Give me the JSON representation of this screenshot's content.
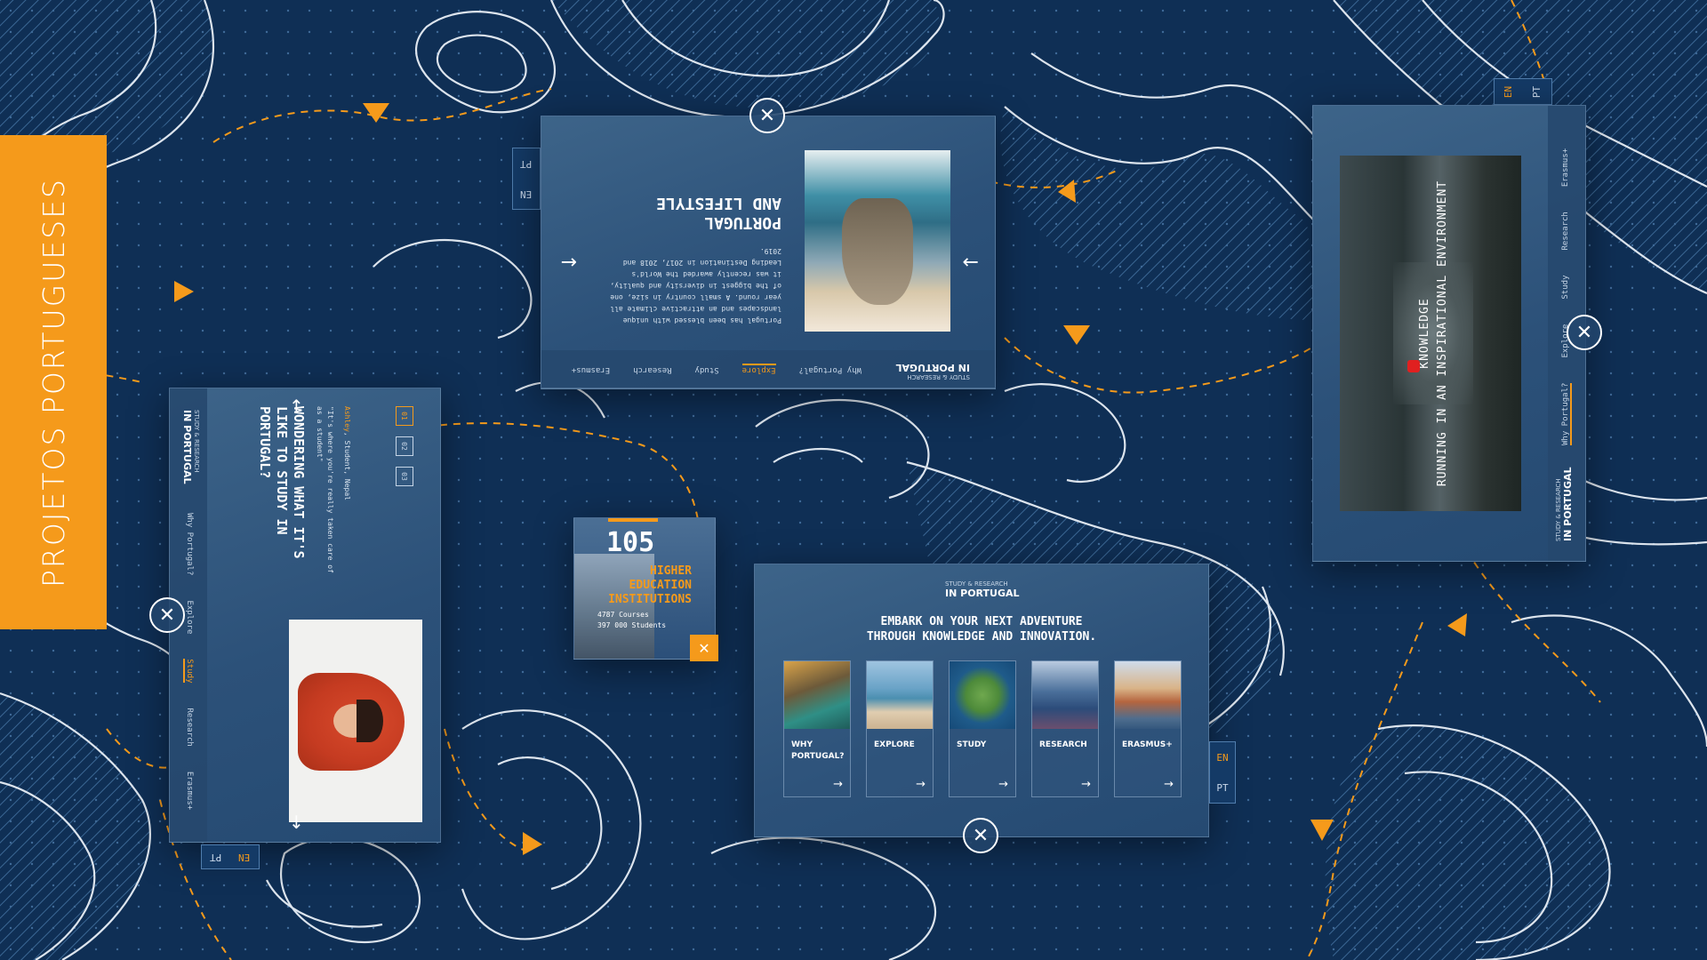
{
  "sidebar_title": "PROJETOS PORTUGUESES",
  "lang": {
    "en": "EN",
    "pt": "PT"
  },
  "brand": {
    "small": "STUDY & RESEARCH",
    "big": "IN PORTUGAL"
  },
  "nav": [
    "Why Portugal?",
    "Explore",
    "Study",
    "Research",
    "Erasmus+"
  ],
  "close_glyph": "✕",
  "lifestyle": {
    "title_line1": "PORTUGAL",
    "title_line2": "AND LIFESTYLE",
    "body": "Portugal has been blessed with unique landscapes and an attractive climate all year round. A small country in size, one of the biggest in diversity and quality, it was recently awarded the World's Leading Destination in 2017, 2018 and 2019.",
    "prev": "←",
    "next": "→"
  },
  "wondering": {
    "title": "WONDERING WHAT IT'S LIKE TO STUDY IN PORTUGAL?",
    "quote": "\"It's where you're really taken care of as a student\"",
    "author_name": "Ashley",
    "author_meta": ", Student, Nepal",
    "pages": [
      "01",
      "02",
      "03"
    ],
    "up": "↑",
    "down": "↓"
  },
  "stat": {
    "number": "105",
    "line1": "HIGHER",
    "line2": "EDUCATION",
    "line3": "INSTITUTIONS",
    "courses": "4787 Courses",
    "students": "397 000 Students"
  },
  "embark": {
    "headline1": "EMBARK ON YOUR NEXT ADVENTURE",
    "headline2": "THROUGH KNOWLEDGE AND INNOVATION.",
    "cards": [
      {
        "line1": "WHY",
        "line2": "PORTUGAL?"
      },
      {
        "line1": "EXPLORE",
        "line2": ""
      },
      {
        "line1": "STUDY",
        "line2": ""
      },
      {
        "line1": "RESEARCH",
        "line2": ""
      },
      {
        "line1": "ERASMUS+",
        "line2": ""
      }
    ],
    "go": "→"
  },
  "video": {
    "line1": "KNOWLEDGE",
    "line2": "RUNNING IN AN INSPIRATIONAL ENVIRONMENT"
  },
  "colors": {
    "accent": "#f59a1b",
    "background": "#0f2f55",
    "panel": "#2c5179"
  }
}
